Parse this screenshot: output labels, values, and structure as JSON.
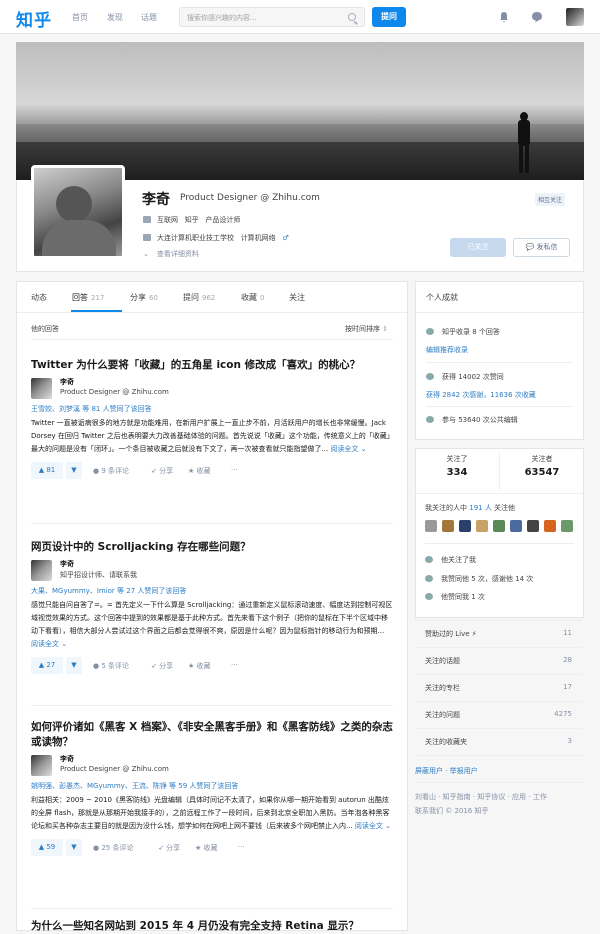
{
  "topbar": {
    "logo": "知乎",
    "nav": [
      "首页",
      "发现",
      "话题"
    ],
    "search_placeholder": "搜索你感兴趣的内容...",
    "ask": "提问"
  },
  "profile": {
    "name": "李奇",
    "headline": "Product Designer @ Zhihu.com",
    "mutual": "相互关注",
    "industry": "互联网",
    "company": "知乎",
    "job": "产品设计师",
    "school": "大连计算机职业技工学校",
    "major": "计算机网络",
    "more": "查看详细资料",
    "followed_btn": "已关注",
    "message_btn": "发私信"
  },
  "tabs": [
    {
      "label": "动态",
      "count": ""
    },
    {
      "label": "回答",
      "count": "217"
    },
    {
      "label": "分享",
      "count": "60"
    },
    {
      "label": "提问",
      "count": "962"
    },
    {
      "label": "收藏",
      "count": "0"
    },
    {
      "label": "关注",
      "count": ""
    }
  ],
  "answers_head": {
    "title": "他的回答",
    "sort": "按时间排序"
  },
  "answers": [
    {
      "question": "Twitter 为什么要将「收藏」的五角星 icon 修改成「喜欢」的桃心？",
      "author": "李奇",
      "author_bio": "Product Designer @ Zhihu.com",
      "voters": "王雪姣、刘梦溪 等 81 人赞同了该回答",
      "body": "Twitter 一直被诟病很多的地方就是功能难用，在新用户扩展上一直止步不前，月活跃用户的增长也非常缓慢。Jack Dorsey 在回归 Twitter 之后也表明要大力改善基础体验的问题。首先说说「收藏」这个功能，传统意义上的「收藏」最大的问题是没有「闭环」。一个条目被收藏之后就没有下文了，再一次被查看就只能指望做了...",
      "more": "阅读全文 ⌄",
      "upvotes": "▲ 81",
      "comments": "9 条评论",
      "share": "分享",
      "collect": "收藏",
      "dots": "···"
    },
    {
      "question": "网页设计中的 Scrolljacking 存在哪些问题？",
      "author": "李奇",
      "author_bio": "知乎招设计师、请联系我",
      "voters": "大果、MGyummy、Imior 等 27 人赞同了该回答",
      "body": "感觉只能自问自答了=。= 首先定义一下什么算是 Scrolljacking：通过重新定义鼠标滚动速度、幅度达到控制可视区域视觉效果的方式。这个回答中提到的效果都是基于此种方式。首先来看下这个例子（把你的鼠标在下半个区域中移动下看看），相信大部分人尝试过这个界面之后都会觉得很不爽，原因是什么呢？因为鼠标指针的移动行为和预期...",
      "more": "阅读全文 ⌄",
      "upvotes": "▲ 27",
      "comments": "5 条评论",
      "share": "分享",
      "collect": "收藏",
      "dots": "···"
    },
    {
      "question": "如何评价诸如《黑客 X 档案》、《非安全黑客手册》和《黑客防线》之类的杂志或读物？",
      "author": "李奇",
      "author_bio": "Product Designer @ Zhihu.com",
      "voters": "姚明强、彭愚杰、MGyummy、王流、陈铮 等 59 人赞同了该回答",
      "body": "利益相关：2009 ~ 2010《黑客防线》光盘编辑（具体时间记不太清了，如果你从哪一期开始看到 autorun 出酷炫的全屏 flash，那就是从那期开始我接手的），之前远程工作了一段时间，后来到北京全职加入黑防。当年泡各种黑客论坛和买各种杂志主要目的就是因为没什么钱，想学如何在网吧上网不要钱（后来被多个网吧禁止入内...",
      "more": "阅读全文 ⌄",
      "upvotes": "▲ 59",
      "comments": "25 条评论",
      "share": "分享",
      "collect": "收藏",
      "dots": "···"
    },
    {
      "question": "为什么一些知名网站到 2015 年 4 月仍没有完全支持 Retina 显示？"
    }
  ],
  "achievements": {
    "title": "个人成就",
    "included": "知乎收录 8 个回答",
    "edit_link": "编辑推荐收录",
    "upvotes": "获得 14002 次赞同",
    "thanks_link": "获得 2842 次感谢，11636 次收藏",
    "edits": "参与 53640 次公共编辑"
  },
  "follow": {
    "following_label": "关注了",
    "following": "334",
    "followers_label": "关注者",
    "followers": "63547",
    "common_prefix": "我关注的人中",
    "common_count": "191 人",
    "common_suffix": "关注他",
    "followed_me": "他关注了我",
    "i_upvoted": "我赞同他 5 次，感谢他 14 次",
    "he_upvoted": "他赞同我 1 次"
  },
  "side_lists": [
    {
      "label": "赞助过的 Live ⚡",
      "value": "11"
    },
    {
      "label": "关注的话题",
      "value": "28"
    },
    {
      "label": "关注的专栏",
      "value": "17"
    },
    {
      "label": "关注的问题",
      "value": "4275"
    },
    {
      "label": "关注的收藏夹",
      "value": "3"
    }
  ],
  "side_links": "屏蔽用户 · 举报用户",
  "footer1": "刘看山 · 知乎指南 · 知乎协议 · 应用 · 工作",
  "footer2": "联系我们 © 2016 知乎",
  "colors": {
    "accent": "#0f88eb",
    "link": "#2d7dc6"
  }
}
